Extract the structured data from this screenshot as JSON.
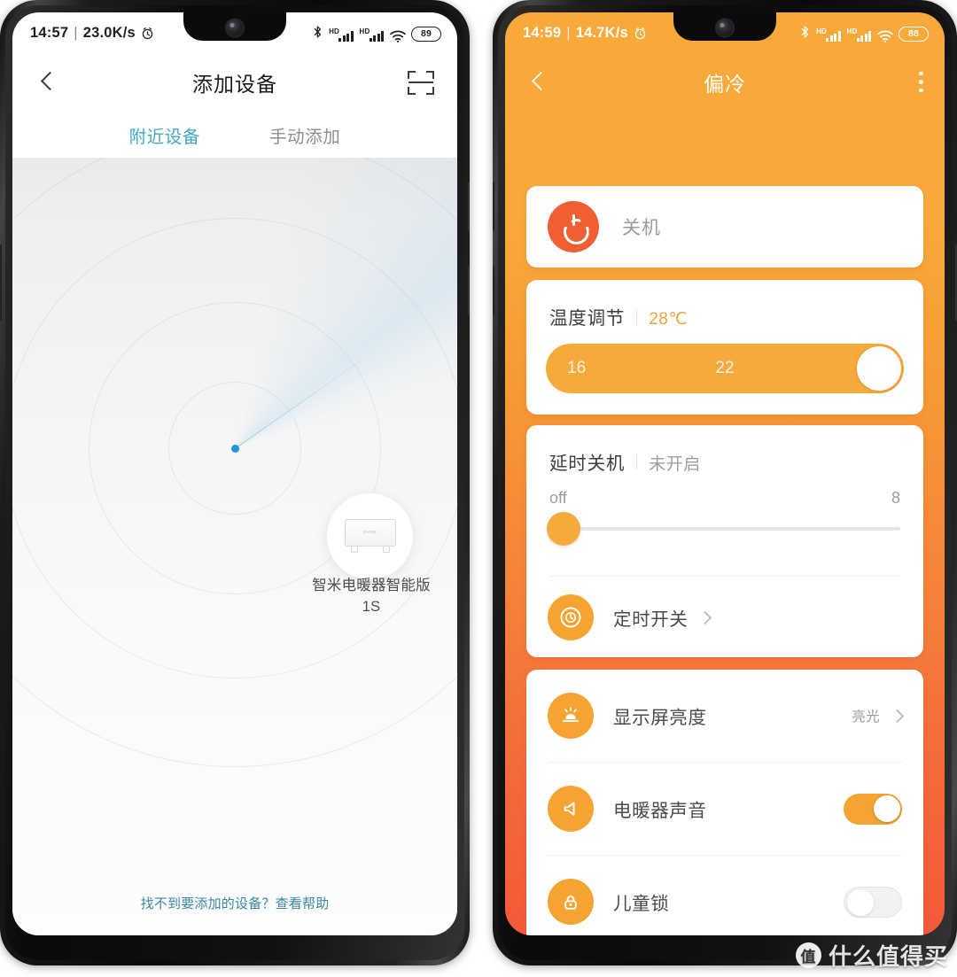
{
  "left_phone": {
    "status_bar": {
      "time": "14:57",
      "separator": "|",
      "net_speed": "23.0K/s",
      "alarm_icon": "alarm-clock-icon",
      "bluetooth_icon": "bluetooth-icon",
      "hd_label": "HD",
      "wifi_icon": "wifi-icon",
      "battery": "89"
    },
    "header": {
      "back_icon": "chevron-left-icon",
      "title": "添加设备",
      "scan_icon": "scan-qr-icon"
    },
    "tabs": [
      {
        "label": "附近设备",
        "active": true
      },
      {
        "label": "手动添加",
        "active": false
      }
    ],
    "radar": {
      "device_name": "智米电暖器智能版1S",
      "device_icon": "heater-icon",
      "center_dot": "radar-center-dot"
    },
    "footer_link": "找不到要添加的设备？查看帮助"
  },
  "right_phone": {
    "status_bar": {
      "time": "14:59",
      "separator": "|",
      "net_speed": "14.7K/s",
      "alarm_icon": "alarm-clock-icon",
      "bluetooth_icon": "bluetooth-icon",
      "hd_label": "HD",
      "wifi_icon": "wifi-icon",
      "battery": "88"
    },
    "header": {
      "back_icon": "chevron-left-icon",
      "title": "偏冷",
      "menu_icon": "more-vertical-icon"
    },
    "power_card": {
      "icon": "power-icon",
      "label": "关机"
    },
    "temperature_card": {
      "title": "温度调节",
      "separator": "|",
      "value": "28℃",
      "slider": {
        "min_label": "16",
        "mid_label": "22",
        "knob": "temperature-slider-knob"
      }
    },
    "delay_card": {
      "title": "延时关机",
      "separator": "|",
      "value": "未开启",
      "slider": {
        "left_label": "off",
        "right_label": "8",
        "knob": "delay-slider-knob"
      },
      "timer_row": {
        "icon": "clock-icon",
        "label": "定时开关",
        "chevron": "chevron-right-icon"
      }
    },
    "settings_card": {
      "rows": [
        {
          "icon": "brightness-icon",
          "label": "显示屏亮度",
          "value": "亮光",
          "type": "link"
        },
        {
          "icon": "speaker-icon",
          "label": "电暖器声音",
          "value": "on",
          "type": "toggle"
        },
        {
          "icon": "lock-icon",
          "label": "儿童锁",
          "value": "off",
          "type": "toggle"
        }
      ]
    }
  },
  "watermark": {
    "badge": "值",
    "text": "什么值得买"
  },
  "colors": {
    "accent_orange": "#f5a431",
    "power_red": "#ef5f32",
    "tab_active_blue": "#41a8c6",
    "link_blue": "#3a86a8",
    "bg_gradient_top": "#f9a93a",
    "bg_gradient_bottom": "#f35a38",
    "radar_dot_blue": "#2196d6"
  }
}
